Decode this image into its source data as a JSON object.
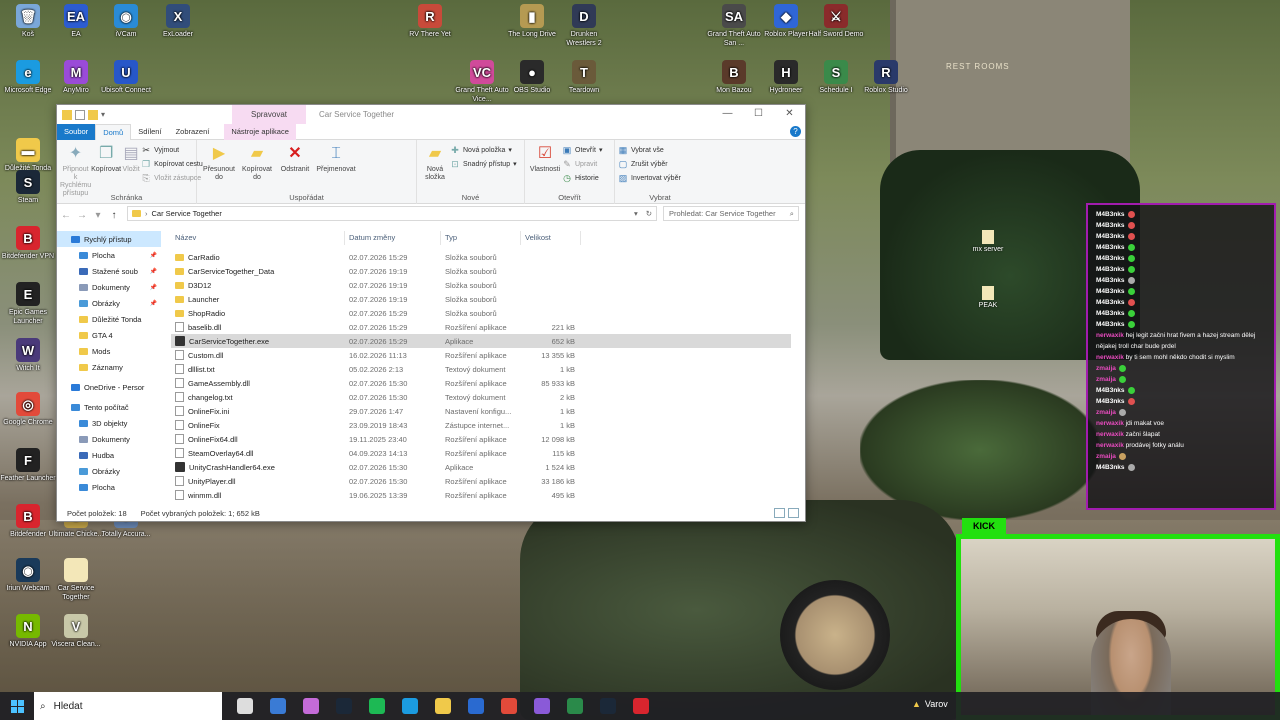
{
  "desktop_icons": [
    {
      "label": "Koš",
      "color": "#7aa7d8",
      "glyph": "🗑"
    },
    {
      "label": "EA",
      "color": "#2c5cd1",
      "glyph": "EA"
    },
    {
      "label": "iVCam",
      "color": "#2a8bd6",
      "glyph": "◉"
    },
    {
      "label": "ExLoader",
      "color": "#314d7a",
      "glyph": "X"
    },
    {
      "label": "RV There Yet",
      "color": "#c84a3a",
      "glyph": "R"
    },
    {
      "label": "The Long Drive",
      "color": "#b59a52",
      "glyph": "▮"
    },
    {
      "label": "Drunken Wrestlers 2",
      "color": "#303a56",
      "glyph": "D"
    },
    {
      "label": "Grand Theft Auto San ...",
      "color": "#4a4a4a",
      "glyph": "SA"
    },
    {
      "label": "Roblox Player",
      "color": "#2f66d6",
      "glyph": "◆"
    },
    {
      "label": "Half Sword Demo",
      "color": "#8a2b2b",
      "glyph": "⚔"
    },
    {
      "label": "Microsoft Edge",
      "color": "#1b9be0",
      "glyph": "e"
    },
    {
      "label": "AnyMiro",
      "color": "#9a4bd8",
      "glyph": "M"
    },
    {
      "label": "Ubisoft Connect",
      "color": "#2757c9",
      "glyph": "U"
    },
    {
      "label": "Grand Theft Auto Vice...",
      "color": "#d04a9a",
      "glyph": "VC"
    },
    {
      "label": "OBS Studio",
      "color": "#2a2a2a",
      "glyph": "●"
    },
    {
      "label": "Teardown",
      "color": "#6a5a3a",
      "glyph": "T"
    },
    {
      "label": "Mon Bazou",
      "color": "#5a3a2a",
      "glyph": "B"
    },
    {
      "label": "Hydroneer",
      "color": "#2a2a2a",
      "glyph": "H"
    },
    {
      "label": "Schedule I",
      "color": "#3a8a4a",
      "glyph": "S"
    },
    {
      "label": "Roblox Studio",
      "color": "#2a3a6a",
      "glyph": "R"
    },
    {
      "label": "Důležité Tonda",
      "color": "#f0c94a",
      "glyph": "▬"
    },
    {
      "label": "Steam",
      "color": "#1b2838",
      "glyph": "S"
    },
    {
      "label": "Bitdefender VPN",
      "color": "#d8252e",
      "glyph": "B"
    },
    {
      "label": "Epic Games Launcher",
      "color": "#222222",
      "glyph": "E"
    },
    {
      "label": "Witch It",
      "color": "#4a3a7a",
      "glyph": "W"
    },
    {
      "label": "Google Chrome",
      "color": "#e24a3a",
      "glyph": "◎"
    },
    {
      "label": "Feather Launcher",
      "color": "#222222",
      "glyph": "F"
    },
    {
      "label": "Bitdefender",
      "color": "#d8252e",
      "glyph": "B"
    },
    {
      "label": "Ultimate Chicke...",
      "color": "#c8a84a",
      "glyph": "U"
    },
    {
      "label": "Totally Accura...",
      "color": "#6a8ab8",
      "glyph": "T"
    },
    {
      "label": "Iriun Webcam",
      "color": "#1a3a5a",
      "glyph": "◉"
    },
    {
      "label": "Car Service Together",
      "color": "#f3e7b8",
      "glyph": ""
    },
    {
      "label": "NVIDIA App",
      "color": "#76b900",
      "glyph": "N"
    },
    {
      "label": "Viscera Clean...",
      "color": "#c8c8a8",
      "glyph": "V"
    }
  ],
  "scene": {
    "sign_text": "REST ROOMS",
    "float_items": [
      {
        "label": "mx server"
      },
      {
        "label": "PEAK"
      }
    ]
  },
  "explorer": {
    "context_tab": "Spravovat",
    "title": "Car Service Together",
    "tabs": [
      "Soubor",
      "Domů",
      "Sdílení",
      "Zobrazení",
      "Nástroje aplikace"
    ],
    "ribbon": {
      "clipboard": {
        "pin_label": "Připnout k Rychlému přístupu",
        "copy_label": "Kopírovat",
        "paste_label": "Vložit",
        "cut_label": "Vyjmout",
        "copy_path_label": "Kopírovat cestu",
        "paste_shortcut_label": "Vložit zástupce",
        "group_label": "Schránka"
      },
      "organize": {
        "move_label": "Přesunout do",
        "copy_to_label": "Kopírovat do",
        "delete_label": "Odstranit",
        "rename_label": "Přejmenovat",
        "group_label": "Uspořádat"
      },
      "new": {
        "new_folder_label": "Nová složka",
        "new_item_label": "Nová položka",
        "easy_access_label": "Snadný přístup",
        "group_label": "Nové"
      },
      "open": {
        "properties_label": "Vlastnosti",
        "open_label": "Otevřít",
        "edit_label": "Upravit",
        "history_label": "Historie",
        "group_label": "Otevřít"
      },
      "select": {
        "select_all_label": "Vybrat vše",
        "select_none_label": "Zrušit výběr",
        "invert_label": "Invertovat výběr",
        "group_label": "Vybrat"
      }
    },
    "address": "Car Service Together",
    "search_placeholder": "Prohledat: Car Service Together",
    "nav_items": [
      {
        "label": "Rychlý přístup",
        "kind": "star",
        "pinned": false
      },
      {
        "label": "Plocha",
        "kind": "blue",
        "pinned": true
      },
      {
        "label": "Stažené soub",
        "kind": "down",
        "pinned": true
      },
      {
        "label": "Dokumenty",
        "kind": "doc",
        "pinned": true
      },
      {
        "label": "Obrázky",
        "kind": "pic",
        "pinned": true
      },
      {
        "label": "Důležité Tonda",
        "kind": "folder",
        "pinned": false
      },
      {
        "label": "GTA 4",
        "kind": "folder",
        "pinned": false
      },
      {
        "label": "Mods",
        "kind": "folder",
        "pinned": false
      },
      {
        "label": "Záznamy",
        "kind": "folder",
        "pinned": false
      },
      {
        "label": "OneDrive - Persor",
        "kind": "cloud",
        "pinned": false
      },
      {
        "label": "Tento počítač",
        "kind": "pc",
        "pinned": false
      },
      {
        "label": "3D objekty",
        "kind": "blue",
        "pinned": false
      },
      {
        "label": "Dokumenty",
        "kind": "doc",
        "pinned": false
      },
      {
        "label": "Hudba",
        "kind": "music",
        "pinned": false
      },
      {
        "label": "Obrázky",
        "kind": "pic",
        "pinned": false
      },
      {
        "label": "Plocha",
        "kind": "blue",
        "pinned": false
      }
    ],
    "columns": [
      "Název",
      "Datum změny",
      "Typ",
      "Velikost"
    ],
    "files": [
      {
        "name": "CarRadio",
        "date": "02.07.2026 15:29",
        "type": "Složka souborů",
        "size": "",
        "kind": "folder"
      },
      {
        "name": "CarServiceTogether_Data",
        "date": "02.07.2026 19:19",
        "type": "Složka souborů",
        "size": "",
        "kind": "folder"
      },
      {
        "name": "D3D12",
        "date": "02.07.2026 19:19",
        "type": "Složka souborů",
        "size": "",
        "kind": "folder"
      },
      {
        "name": "Launcher",
        "date": "02.07.2026 19:19",
        "type": "Složka souborů",
        "size": "",
        "kind": "folder"
      },
      {
        "name": "ShopRadio",
        "date": "02.07.2026 15:29",
        "type": "Složka souborů",
        "size": "",
        "kind": "folder"
      },
      {
        "name": "baselib.dll",
        "date": "02.07.2026 15:29",
        "type": "Rozšíření aplikace",
        "size": "221 kB",
        "kind": "file"
      },
      {
        "name": "CarServiceTogether.exe",
        "date": "02.07.2026 15:29",
        "type": "Aplikace",
        "size": "652 kB",
        "kind": "exe",
        "selected": true
      },
      {
        "name": "Custom.dll",
        "date": "16.02.2026 11:13",
        "type": "Rozšíření aplikace",
        "size": "13 355 kB",
        "kind": "file"
      },
      {
        "name": "dlllist.txt",
        "date": "05.02.2026 2:13",
        "type": "Textový dokument",
        "size": "1 kB",
        "kind": "file"
      },
      {
        "name": "GameAssembly.dll",
        "date": "02.07.2026 15:30",
        "type": "Rozšíření aplikace",
        "size": "85 933 kB",
        "kind": "file"
      },
      {
        "name": "changelog.txt",
        "date": "02.07.2026 15:30",
        "type": "Textový dokument",
        "size": "2 kB",
        "kind": "file"
      },
      {
        "name": "OnlineFix.ini",
        "date": "29.07.2026 1:47",
        "type": "Nastavení konfigu...",
        "size": "1 kB",
        "kind": "file"
      },
      {
        "name": "OnlineFix",
        "date": "23.09.2019 18:43",
        "type": "Zástupce internet...",
        "size": "1 kB",
        "kind": "file"
      },
      {
        "name": "OnlineFix64.dll",
        "date": "19.11.2025 23:40",
        "type": "Rozšíření aplikace",
        "size": "12 098 kB",
        "kind": "file"
      },
      {
        "name": "SteamOverlay64.dll",
        "date": "04.09.2023 14:13",
        "type": "Rozšíření aplikace",
        "size": "115 kB",
        "kind": "file"
      },
      {
        "name": "UnityCrashHandler64.exe",
        "date": "02.07.2026 15:30",
        "type": "Aplikace",
        "size": "1 524 kB",
        "kind": "exe"
      },
      {
        "name": "UnityPlayer.dll",
        "date": "02.07.2026 15:30",
        "type": "Rozšíření aplikace",
        "size": "33 186 kB",
        "kind": "file"
      },
      {
        "name": "winmm.dll",
        "date": "19.06.2025 13:39",
        "type": "Rozšíření aplikace",
        "size": "495 kB",
        "kind": "file"
      }
    ],
    "status_count": "Počet položek: 18",
    "status_selected": "Počet vybraných položek: 1; 652 kB"
  },
  "chat": {
    "messages": [
      {
        "user": "M4B3nks",
        "text": "",
        "user_color": "#ffffff",
        "emote": "#e05050"
      },
      {
        "user": "M4B3nks",
        "text": "",
        "user_color": "#ffffff",
        "emote": "#e05050"
      },
      {
        "user": "M4B3nks",
        "text": "",
        "user_color": "#ffffff",
        "emote": "#e05050"
      },
      {
        "user": "M4B3nks",
        "text": "",
        "user_color": "#ffffff",
        "emote": "#3ad03a"
      },
      {
        "user": "M4B3nks",
        "text": "",
        "user_color": "#ffffff",
        "emote": "#3ad03a"
      },
      {
        "user": "M4B3nks",
        "text": "",
        "user_color": "#ffffff",
        "emote": "#3ad03a"
      },
      {
        "user": "M4B3nks",
        "text": "",
        "user_color": "#ffffff",
        "emote": "#aaaaaa"
      },
      {
        "user": "M4B3nks",
        "text": "",
        "user_color": "#ffffff",
        "emote": "#3ad03a"
      },
      {
        "user": "M4B3nks",
        "text": "",
        "user_color": "#ffffff",
        "emote": "#e05050"
      },
      {
        "user": "M4B3nks",
        "text": "",
        "user_color": "#ffffff",
        "emote": "#3ad03a"
      },
      {
        "user": "M4B3nks",
        "text": "",
        "user_color": "#ffffff",
        "emote": "#3ad03a"
      },
      {
        "user": "nerwaxik",
        "text": "hej legit začni hrat fivem a hazej stream dělej nějakej troll char bude prdel",
        "user_color": "#e94bbf",
        "emote": ""
      },
      {
        "user": "nerwaxik",
        "text": "by ti sem mohl někdo chodit si myslim",
        "user_color": "#e94bbf",
        "emote": ""
      },
      {
        "user": "zmaija",
        "text": "",
        "user_color": "#e94bbf",
        "emote": "#3ad03a"
      },
      {
        "user": "zmaija",
        "text": "",
        "user_color": "#e94bbf",
        "emote": "#3ad03a"
      },
      {
        "user": "M4B3nks",
        "text": "",
        "user_color": "#ffffff",
        "emote": "#3ad03a"
      },
      {
        "user": "M4B3nks",
        "text": "",
        "user_color": "#ffffff",
        "emote": "#e05050"
      },
      {
        "user": "zmaija",
        "text": "",
        "user_color": "#e94bbf",
        "emote": "#aaaaaa"
      },
      {
        "user": "nerwaxik",
        "text": "jdi makat voe",
        "user_color": "#e94bbf",
        "emote": ""
      },
      {
        "user": "nerwaxik",
        "text": "začni šlapat",
        "user_color": "#e94bbf",
        "emote": ""
      },
      {
        "user": "nerwaxik",
        "text": "prodávej fotky análu",
        "user_color": "#e94bbf",
        "emote": ""
      },
      {
        "user": "zmaija",
        "text": "",
        "user_color": "#e94bbf",
        "emote": "#c8a060"
      },
      {
        "user": "M4B3nks",
        "text": "",
        "user_color": "#ffffff",
        "emote": "#aaaaaa"
      }
    ]
  },
  "cam": {
    "badge": "KICK"
  },
  "taskbar": {
    "search_label": "Hledat",
    "apps": [
      {
        "name": "task-view",
        "color": "#dddddd"
      },
      {
        "name": "store",
        "color": "#3a7bd5"
      },
      {
        "name": "copilot",
        "color": "#c46bd8"
      },
      {
        "name": "steam",
        "color": "#1b2838"
      },
      {
        "name": "spotify",
        "color": "#1db954"
      },
      {
        "name": "edge",
        "color": "#1b9be0"
      },
      {
        "name": "explorer",
        "color": "#f0c94a"
      },
      {
        "name": "app-blue",
        "color": "#2a6ad0"
      },
      {
        "name": "chrome",
        "color": "#e24a3a"
      },
      {
        "name": "discord-like",
        "color": "#8a5ad8"
      },
      {
        "name": "app-green",
        "color": "#2a8a4a"
      },
      {
        "name": "steam2",
        "color": "#1b2838"
      },
      {
        "name": "bitdefender",
        "color": "#d8252e"
      }
    ],
    "tray_text": "Varov"
  }
}
